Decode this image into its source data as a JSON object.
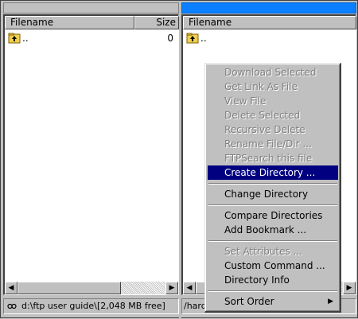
{
  "left_pane": {
    "header": {
      "filename": "Filename",
      "size": "Size"
    },
    "rows": [
      {
        "name": "..",
        "size": "0"
      }
    ],
    "status": {
      "drive_icon": "link-icon",
      "path": "d:\\ftp user guide\\",
      "free": "[2,048 MB free]"
    }
  },
  "right_pane": {
    "header": {
      "filename": "Filename"
    },
    "rows": [
      {
        "name": ".."
      }
    ],
    "status": {
      "path": "/hard"
    }
  },
  "context_menu": {
    "items": [
      {
        "label": "Download Selected",
        "state": "disabled"
      },
      {
        "label": "Get Link As File",
        "state": "disabled"
      },
      {
        "label": "View File",
        "state": "disabled"
      },
      {
        "label": "Delete Selected",
        "state": "disabled"
      },
      {
        "label": "Recursive Delete",
        "state": "disabled"
      },
      {
        "label": "Rename File/Dir ...",
        "state": "disabled"
      },
      {
        "label": "FTPSearch this file",
        "state": "disabled"
      },
      {
        "label": "Create Directory ...",
        "state": "selected"
      },
      {
        "label": "Change Directory",
        "state": "enabled"
      },
      {
        "label": "Compare Directories",
        "state": "enabled"
      },
      {
        "label": "Add Bookmark ...",
        "state": "enabled"
      },
      {
        "label": "Set Attributes ...",
        "state": "disabled"
      },
      {
        "label": "Custom Command ...",
        "state": "enabled"
      },
      {
        "label": "Directory Info",
        "state": "enabled"
      },
      {
        "label": "Sort Order",
        "state": "enabled",
        "submenu": true
      }
    ]
  },
  "colors": {
    "window_bg": "#c0c0c0",
    "active_title": "#0a7fff",
    "menu_highlight": "#000080",
    "disabled_text": "#808080"
  }
}
